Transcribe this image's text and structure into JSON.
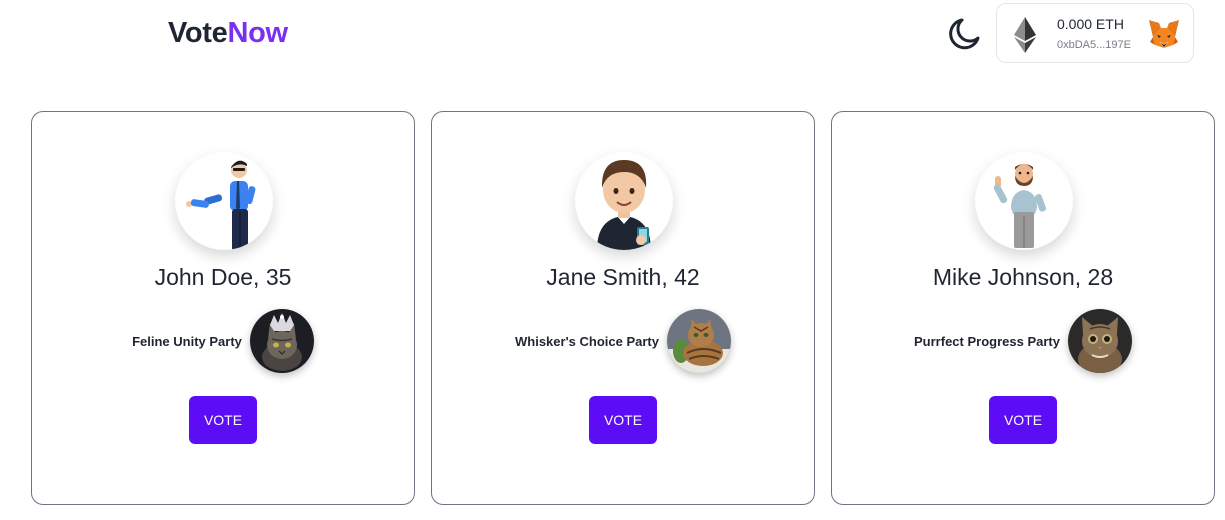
{
  "header": {
    "logo_part1": "Vote",
    "logo_part2": "Now"
  },
  "wallet": {
    "balance": "0.000 ETH",
    "address": "0xbDA5...197E"
  },
  "candidates": [
    {
      "name": "John Doe, 35",
      "party": "Feline Unity Party",
      "vote_label": "VOTE"
    },
    {
      "name": "Jane Smith, 42",
      "party": "Whisker's Choice Party",
      "vote_label": "VOTE"
    },
    {
      "name": "Mike Johnson, 28",
      "party": "Purrfect Progress Party",
      "vote_label": "VOTE"
    }
  ],
  "colors": {
    "brand_accent": "#7b2ff2",
    "vote_button": "#5c0df5",
    "text_dark": "#1f2533"
  },
  "icons": {
    "theme": "moon-icon",
    "currency": "ethereum-icon",
    "wallet_provider": "metamask-fox-icon"
  }
}
